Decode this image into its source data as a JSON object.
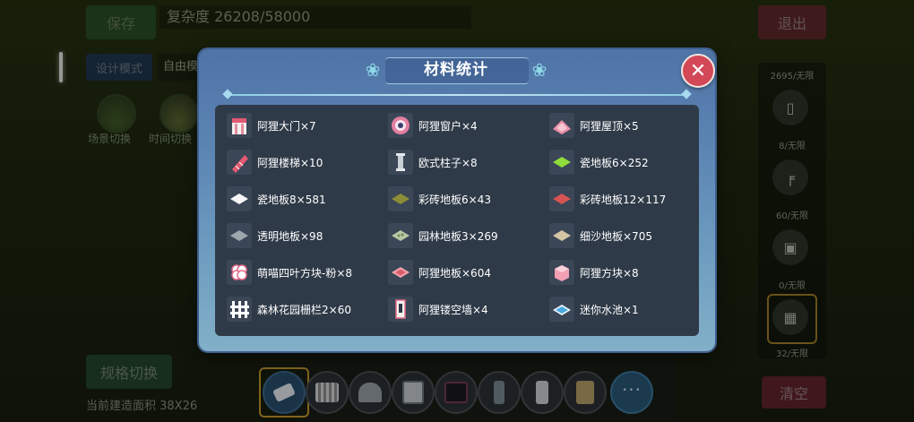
{
  "top": {
    "save_label": "保存",
    "complexity": "复杂度 26208/58000",
    "exit_label": "退出",
    "design_mode_label": "设计模式",
    "free_mode_label": "自由模"
  },
  "scenes": [
    {
      "label": "场景切换"
    },
    {
      "label": "时间切换"
    }
  ],
  "right_column": {
    "counts": [
      "2695/无限",
      "8/无限",
      "60/无限",
      "0/无限",
      "32/无限"
    ],
    "clear_label": "清空"
  },
  "bottom_left": {
    "spec_label": "规格切换",
    "area_text": "当前建造面积 38X26"
  },
  "toolbar": {
    "tools": [
      "eraser-tool",
      "fence-tool",
      "arch-tool",
      "door-tool",
      "screen-tool",
      "column-tool",
      "cabinet-tool",
      "wall-tool",
      "more-tool"
    ],
    "more_label": "···"
  },
  "modal": {
    "title": "材料统计",
    "close_label": "✕",
    "items": [
      {
        "label": "阿狸大门×7",
        "icon": "gate-icon"
      },
      {
        "label": "阿狸窗户×4",
        "icon": "window-icon"
      },
      {
        "label": "阿狸屋顶×5",
        "icon": "roof-icon"
      },
      {
        "label": "阿狸楼梯×10",
        "icon": "stairs-icon"
      },
      {
        "label": "欧式柱子×8",
        "icon": "pillar-icon"
      },
      {
        "label": "瓷地板6×252",
        "icon": "green-tile-icon"
      },
      {
        "label": "瓷地板8×581",
        "icon": "white-tile-icon"
      },
      {
        "label": "彩砖地板6×43",
        "icon": "olive-tile-icon"
      },
      {
        "label": "彩砖地板12×117",
        "icon": "red-tile-icon"
      },
      {
        "label": "透明地板×98",
        "icon": "glass-tile-icon"
      },
      {
        "label": "园林地板3×269",
        "icon": "garden-tile-icon"
      },
      {
        "label": "细沙地板×705",
        "icon": "sand-tile-icon"
      },
      {
        "label": "萌喵四叶方块-粉×8",
        "icon": "clover-block-icon"
      },
      {
        "label": "阿狸地板×604",
        "icon": "ahri-tile-icon"
      },
      {
        "label": "阿狸方块×8",
        "icon": "pink-block-icon"
      },
      {
        "label": "森林花园栅栏2×60",
        "icon": "fence-icon"
      },
      {
        "label": "阿狸镂空墙×4",
        "icon": "hollow-wall-icon"
      },
      {
        "label": "迷你水池×1",
        "icon": "pool-icon"
      }
    ]
  }
}
